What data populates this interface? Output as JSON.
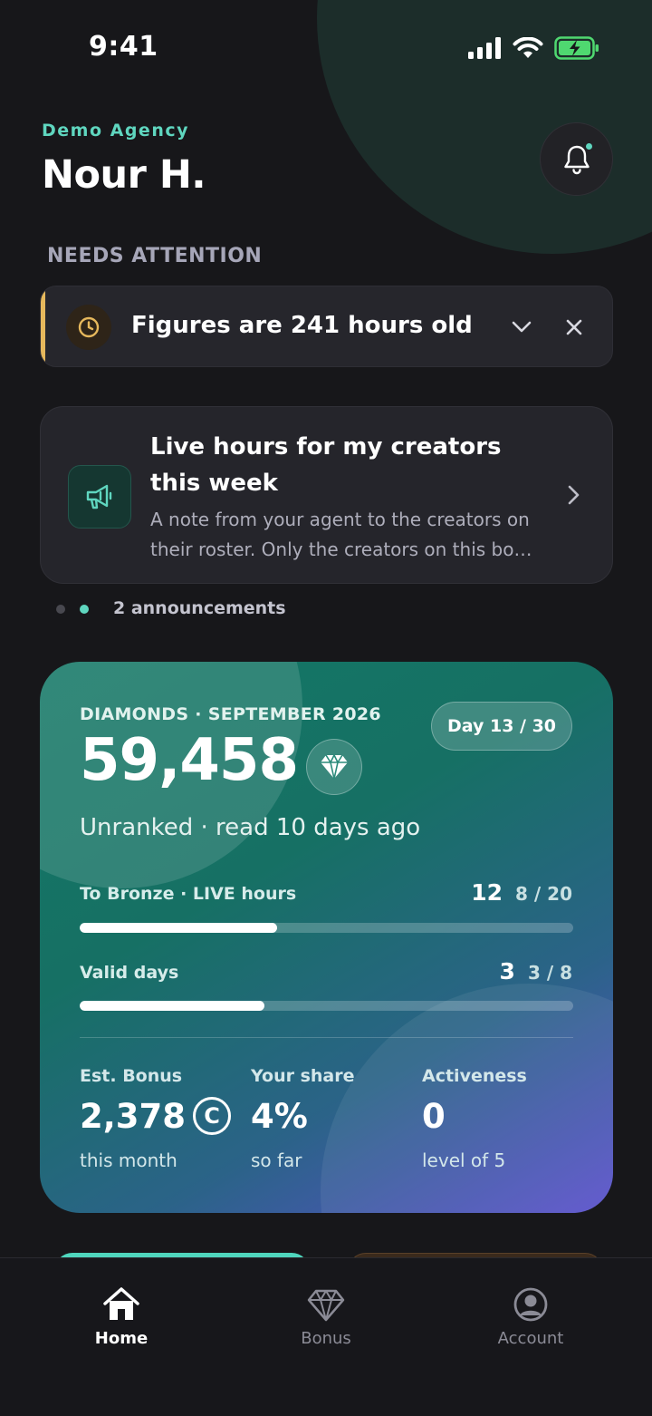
{
  "status_bar": {
    "time": "9:41"
  },
  "header": {
    "agency": "Demo Agency",
    "user_name": "Nour H."
  },
  "attention": {
    "label": "NEEDS ATTENTION",
    "alert_text": "Figures are 241 hours old"
  },
  "announcement": {
    "title": "Live hours for my creators this week",
    "body": "A note from your agent to the creators on their roster. Only the creators on this bo…",
    "count_label": "2 announcements"
  },
  "diamonds": {
    "eyebrow": "DIAMONDS · SEPTEMBER 2026",
    "day_pill": "Day 13 / 30",
    "value": "59,458",
    "rank_text": "Unranked · read 10 days ago",
    "live_hours": {
      "label": "To Bronze · LIVE hours",
      "current": "12",
      "total": "8 / 20",
      "fill_fraction": 0.4
    },
    "valid_days": {
      "label": "Valid days",
      "current": "3",
      "total": "3 / 8",
      "fill_fraction": 0.375
    },
    "stats": [
      {
        "label": "Est. Bonus",
        "value": "2,378",
        "coin_symbol": "C",
        "sub": "this month"
      },
      {
        "label": "Your share",
        "value": "4%",
        "sub": "so far"
      },
      {
        "label": "Activeness",
        "value": "0",
        "sub": "level of 5"
      }
    ]
  },
  "tabs": [
    {
      "label": "Home",
      "icon": "home-icon",
      "active": true
    },
    {
      "label": "Bonus",
      "icon": "diamond-icon",
      "active": false
    },
    {
      "label": "Account",
      "icon": "account-icon",
      "active": false
    }
  ],
  "colors": {
    "accent": "#5fd6bf",
    "alert_accent": "#e6b85c",
    "background": "#17171a"
  }
}
